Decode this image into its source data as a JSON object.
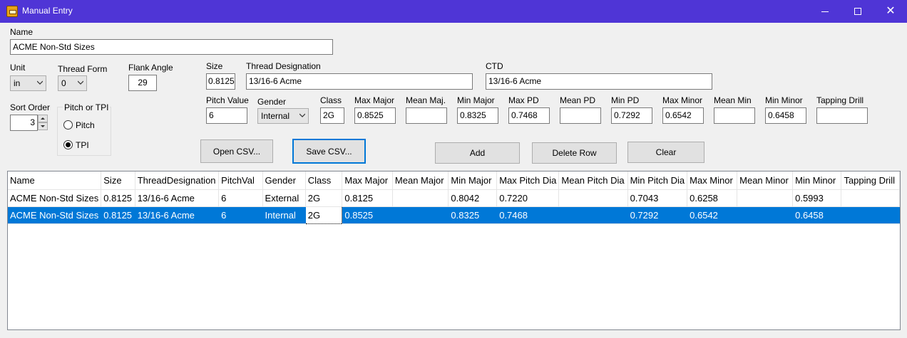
{
  "window": {
    "title": "Manual Entry"
  },
  "form": {
    "name_label": "Name",
    "name_value": "ACME Non-Std Sizes",
    "unit_label": "Unit",
    "unit_value": "in",
    "thread_form_label": "Thread Form",
    "thread_form_value": "0",
    "flank_angle_label": "Flank Angle",
    "flank_angle_value": "29",
    "sort_order_label": "Sort Order",
    "sort_order_value": "3",
    "pitch_or_tpi_label": "Pitch or TPI",
    "pitch_option": "Pitch",
    "tpi_option": "TPI",
    "size_label": "Size",
    "size_value": "0.8125",
    "thread_designation_label": "Thread Designation",
    "thread_designation_value": "13/16-6 Acme",
    "ctd_label": "CTD",
    "ctd_value": "13/16-6 Acme",
    "pitch_value_label": "Pitch Value",
    "pitch_value": "6",
    "gender_label": "Gender",
    "gender_value": "Internal",
    "class_label": "Class",
    "class_value": "2G",
    "max_major_label": "Max Major",
    "max_major_value": "0.8525",
    "mean_major_label": "Mean Maj.",
    "mean_major_value": "",
    "min_major_label": "Min Major",
    "min_major_value": "0.8325",
    "max_pd_label": "Max PD",
    "max_pd_value": "0.7468",
    "mean_pd_label": "Mean PD",
    "mean_pd_value": "",
    "min_pd_label": "Min PD",
    "min_pd_value": "0.7292",
    "max_minor_label": "Max Minor",
    "max_minor_value": "0.6542",
    "mean_min_label": "Mean Min",
    "mean_min_value": "",
    "min_minor_label": "Min Minor",
    "min_minor_value": "0.6458",
    "tapping_drill_label": "Tapping Drill",
    "tapping_drill_value": ""
  },
  "buttons": {
    "open_csv": "Open CSV...",
    "save_csv": "Save CSV...",
    "add": "Add",
    "delete_row": "Delete Row",
    "clear": "Clear"
  },
  "grid": {
    "columns": [
      "Name",
      "Size",
      "ThreadDesignation",
      "PitchVal",
      "Gender",
      "Class",
      "Max Major",
      "Mean Major",
      "Min Major",
      "Max Pitch Dia",
      "Mean Pitch Dia",
      "Min Pitch Dia",
      "Max Minor",
      "Mean Minor",
      "Min Minor",
      "Tapping Drill"
    ],
    "rows": [
      [
        "ACME Non-Std Sizes",
        "0.8125",
        "13/16-6 Acme",
        "6",
        "External",
        "2G",
        "0.8125",
        "",
        "0.8042",
        "0.7220",
        "",
        "0.7043",
        "0.6258",
        "",
        "0.5993",
        ""
      ],
      [
        "ACME Non-Std Sizes",
        "0.8125",
        "13/16-6 Acme",
        "6",
        "Internal",
        "2G",
        "0.8525",
        "",
        "0.8325",
        "0.7468",
        "",
        "0.7292",
        "0.6542",
        "",
        "0.6458",
        ""
      ]
    ],
    "selected_row": 1
  }
}
